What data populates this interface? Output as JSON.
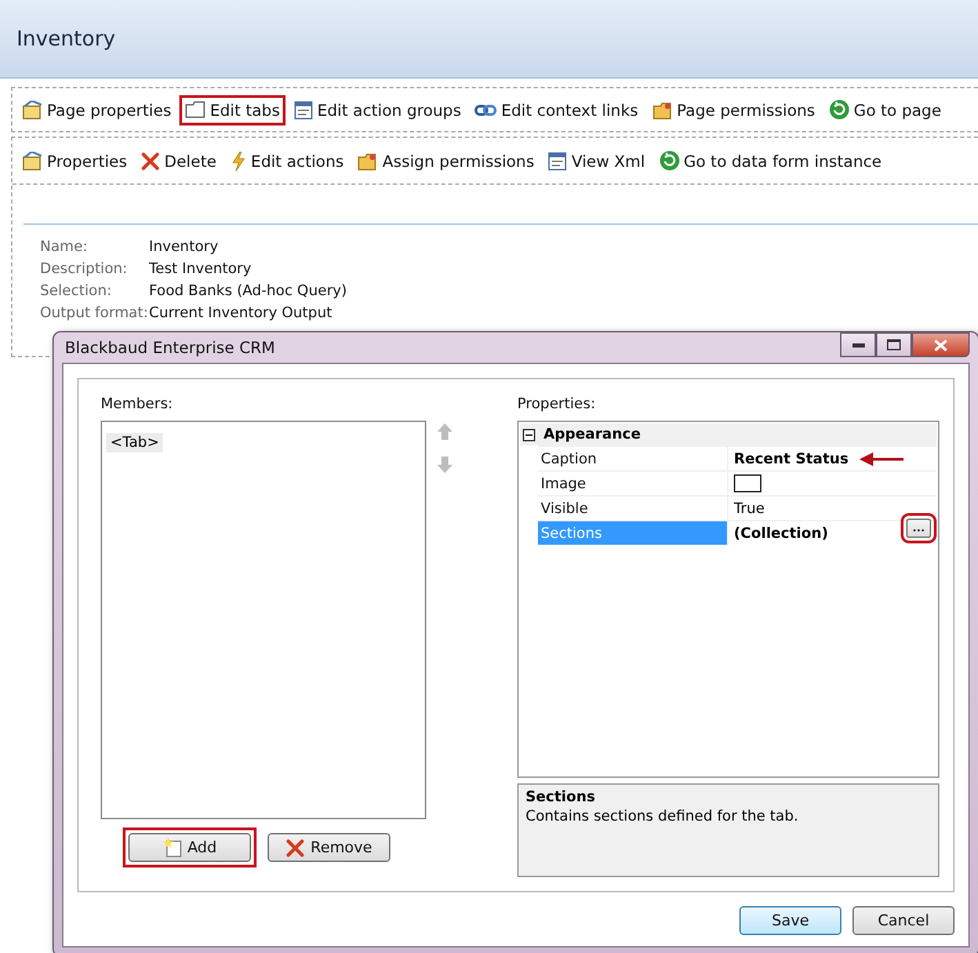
{
  "page": {
    "title": "Inventory"
  },
  "page_toolbar": [
    {
      "label": "Page properties",
      "highlighted": false
    },
    {
      "label": "Edit tabs",
      "highlighted": true
    },
    {
      "label": "Edit action groups",
      "highlighted": false
    },
    {
      "label": "Edit context links",
      "highlighted": false
    },
    {
      "label": "Page permissions",
      "highlighted": false
    },
    {
      "label": "Go to page",
      "highlighted": false
    }
  ],
  "item_toolbar": [
    {
      "label": "Properties",
      "highlighted": false
    },
    {
      "label": "Delete",
      "highlighted": false
    },
    {
      "label": "Edit actions",
      "highlighted": false
    },
    {
      "label": "Assign permissions",
      "highlighted": false
    },
    {
      "label": "View Xml",
      "highlighted": false
    },
    {
      "label": "Go to data form instance",
      "highlighted": false
    }
  ],
  "details": [
    {
      "label": "Name:",
      "value": "Inventory"
    },
    {
      "label": "Description:",
      "value": "Test Inventory"
    },
    {
      "label": "Selection:",
      "value": "Food Banks (Ad-hoc Query)"
    },
    {
      "label": "Output format:",
      "value": "Current Inventory Output"
    }
  ],
  "dialog": {
    "title": "Blackbaud Enterprise CRM",
    "members_label": "Members:",
    "members": [
      {
        "label": "<Tab>",
        "selected": true
      }
    ],
    "move_up_disabled": true,
    "move_down_disabled": true,
    "properties_label": "Properties:",
    "category": {
      "label": "Appearance",
      "expanded": true
    },
    "properties": [
      {
        "name": "Caption",
        "kind": "text",
        "value": "Recent Status",
        "bold": true,
        "arrow": true,
        "selected": false
      },
      {
        "name": "Image",
        "kind": "image",
        "selected": false
      },
      {
        "name": "Visible",
        "kind": "text",
        "value": "True",
        "bold": false,
        "selected": false
      },
      {
        "name": "Sections",
        "kind": "collection",
        "value": "(Collection)",
        "bold": true,
        "selected": true,
        "highlighted": true
      }
    ],
    "description": {
      "title": "Sections",
      "text": "Contains sections defined for the tab."
    },
    "member_buttons": [
      {
        "label": "Add",
        "highlighted": true
      },
      {
        "label": "Remove",
        "highlighted": false
      }
    ],
    "footer_buttons": [
      {
        "label": "Save",
        "default": true
      },
      {
        "label": "Cancel",
        "default": false
      }
    ]
  }
}
